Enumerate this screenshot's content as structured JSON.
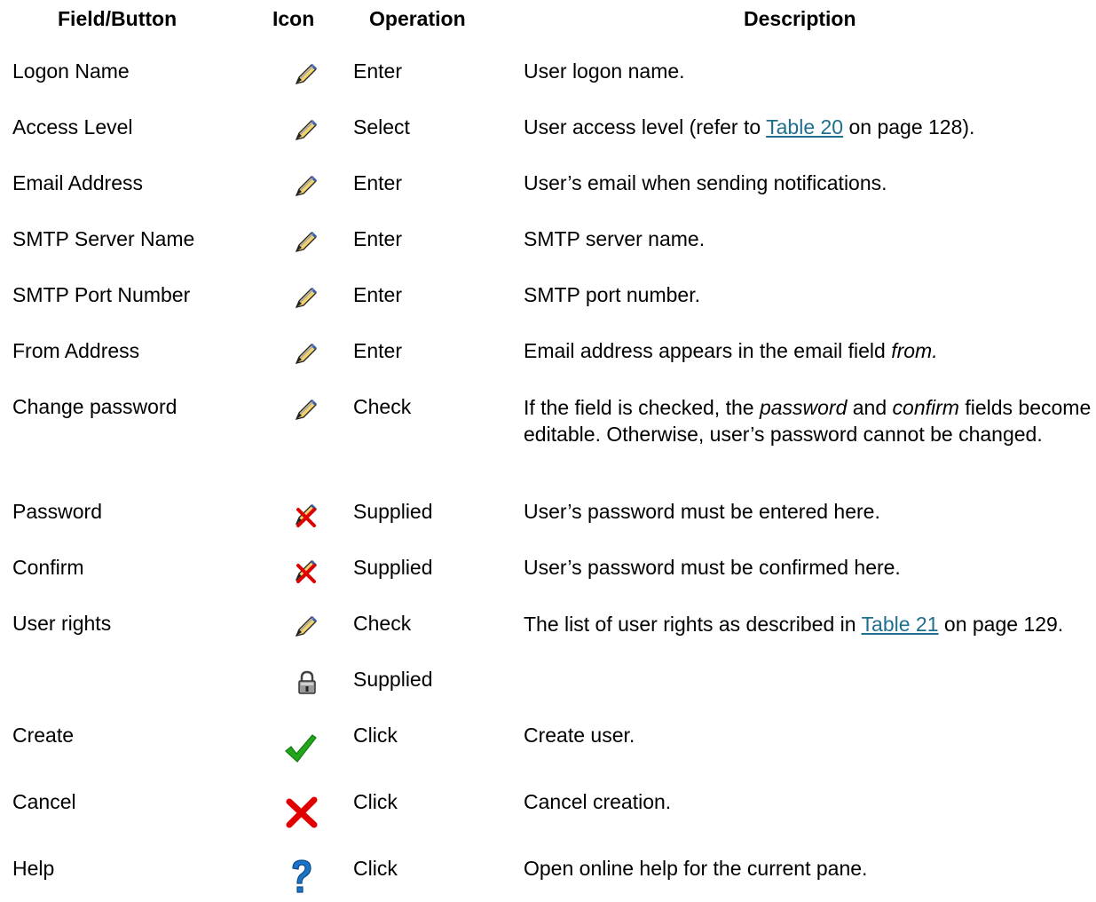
{
  "headers": {
    "field": "Field/Button",
    "icon": "Icon",
    "operation": "Operation",
    "description": "Description"
  },
  "rows": [
    {
      "field": "Logon Name",
      "icon": "pencil-icon",
      "operation": "Enter",
      "description": "User logon name."
    },
    {
      "field": "Access Level",
      "icon": "pencil-icon",
      "operation": "Select",
      "description_pre": "User access level (refer to ",
      "description_link": "Table 20",
      "description_post": " on page 128)."
    },
    {
      "field": "Email Address",
      "icon": "pencil-icon",
      "operation": "Enter",
      "description": "User’s email when sending notifications."
    },
    {
      "field": "SMTP Server Name",
      "icon": "pencil-icon",
      "operation": "Enter",
      "description": "SMTP server name."
    },
    {
      "field": "SMTP Port Number",
      "icon": "pencil-icon",
      "operation": "Enter",
      "description": "SMTP port number."
    },
    {
      "field": "From Address",
      "icon": "pencil-icon",
      "operation": "Enter",
      "description_pre": "Email address appears in the email field ",
      "description_em": "from."
    },
    {
      "field": "Change password",
      "icon": "pencil-icon",
      "operation": "Check",
      "description_pre": "If the field is checked, the ",
      "description_em1": "password",
      "description_mid": " and ",
      "description_em2": "confirm",
      "description_post": " fields become editable. Otherwise, user’s password cannot be changed."
    },
    {
      "field": "Password",
      "icon": "pencil-crossed-icon",
      "operation": "Supplied",
      "description": "User’s password must be entered here."
    },
    {
      "field": "Confirm",
      "icon": "pencil-crossed-icon",
      "operation": "Supplied",
      "description": "User’s password must be confirmed here."
    },
    {
      "field": "User rights",
      "icon": "pencil-icon",
      "operation": "Check",
      "description_pre": "The list of user rights as described in ",
      "description_link": "Table 21",
      "description_post": " on page 129.",
      "icon2": "padlock-icon",
      "operation2": "Supplied"
    },
    {
      "field": "Create",
      "icon": "checkmark-icon",
      "operation": "Click",
      "description": "Create user."
    },
    {
      "field": "Cancel",
      "icon": "red-x-icon",
      "operation": "Click",
      "description": "Cancel creation."
    },
    {
      "field": "Help",
      "icon": "question-mark-icon",
      "operation": "Click",
      "description": "Open online help for the current pane."
    }
  ],
  "colors": {
    "link": "#1f6f8f",
    "checkmark": "#22a61a",
    "cancel": "#e00000",
    "help": "#1a74c9"
  }
}
